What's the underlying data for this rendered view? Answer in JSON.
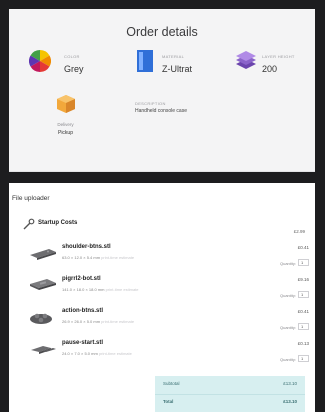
{
  "header": {
    "title": "Order details"
  },
  "attributes": [
    {
      "label": "COLOR",
      "value": "Grey",
      "icon": "color-wheel-icon"
    },
    {
      "label": "MATERIAL",
      "value": "Z-Ultrat",
      "icon": "material-icon"
    },
    {
      "label": "LAYER HEIGHT",
      "value": "200",
      "icon": "layers-icon"
    }
  ],
  "delivery": {
    "label": "Delivery",
    "value": "Pickup",
    "icon": "package-icon"
  },
  "description": {
    "label": "DESCRIPTION",
    "value": "Handheld console case"
  },
  "uploader": {
    "title": "File uploader",
    "startup": {
      "label": "Startup Costs",
      "price": "£2.99",
      "icon": "wrench-icon"
    },
    "quantity_label": "Quantity:",
    "files": [
      {
        "name": "shoulder-btns.stl",
        "dims": "63.0 × 12.0 × 5.4 mm",
        "dims_extra": "print-time estimate",
        "price": "£0.41",
        "qty": "1"
      },
      {
        "name": "pigrrl2-bot.stl",
        "dims": "141.0 × 18.0 × 18.0 mm",
        "dims_extra": "print-time estimate",
        "price": "£9.16",
        "qty": "1"
      },
      {
        "name": "action-btns.stl",
        "dims": "26.9 × 26.0 × 5.0 mm",
        "dims_extra": "print-time estimate",
        "price": "£0.41",
        "qty": "1"
      },
      {
        "name": "pause-start.stl",
        "dims": "24.0 × 7.0 × 5.0 mm",
        "dims_extra": "print-time estimate",
        "price": "£0.13",
        "qty": "1"
      }
    ]
  },
  "summary": {
    "subtotal_label": "Subtotal",
    "subtotal": "£13.10",
    "total_label": "Total",
    "total": "£13.10"
  },
  "colors": {
    "accent": "#d7eff0",
    "material_blue": "#2f6fd8",
    "layers_purple": "#8a63c9"
  }
}
